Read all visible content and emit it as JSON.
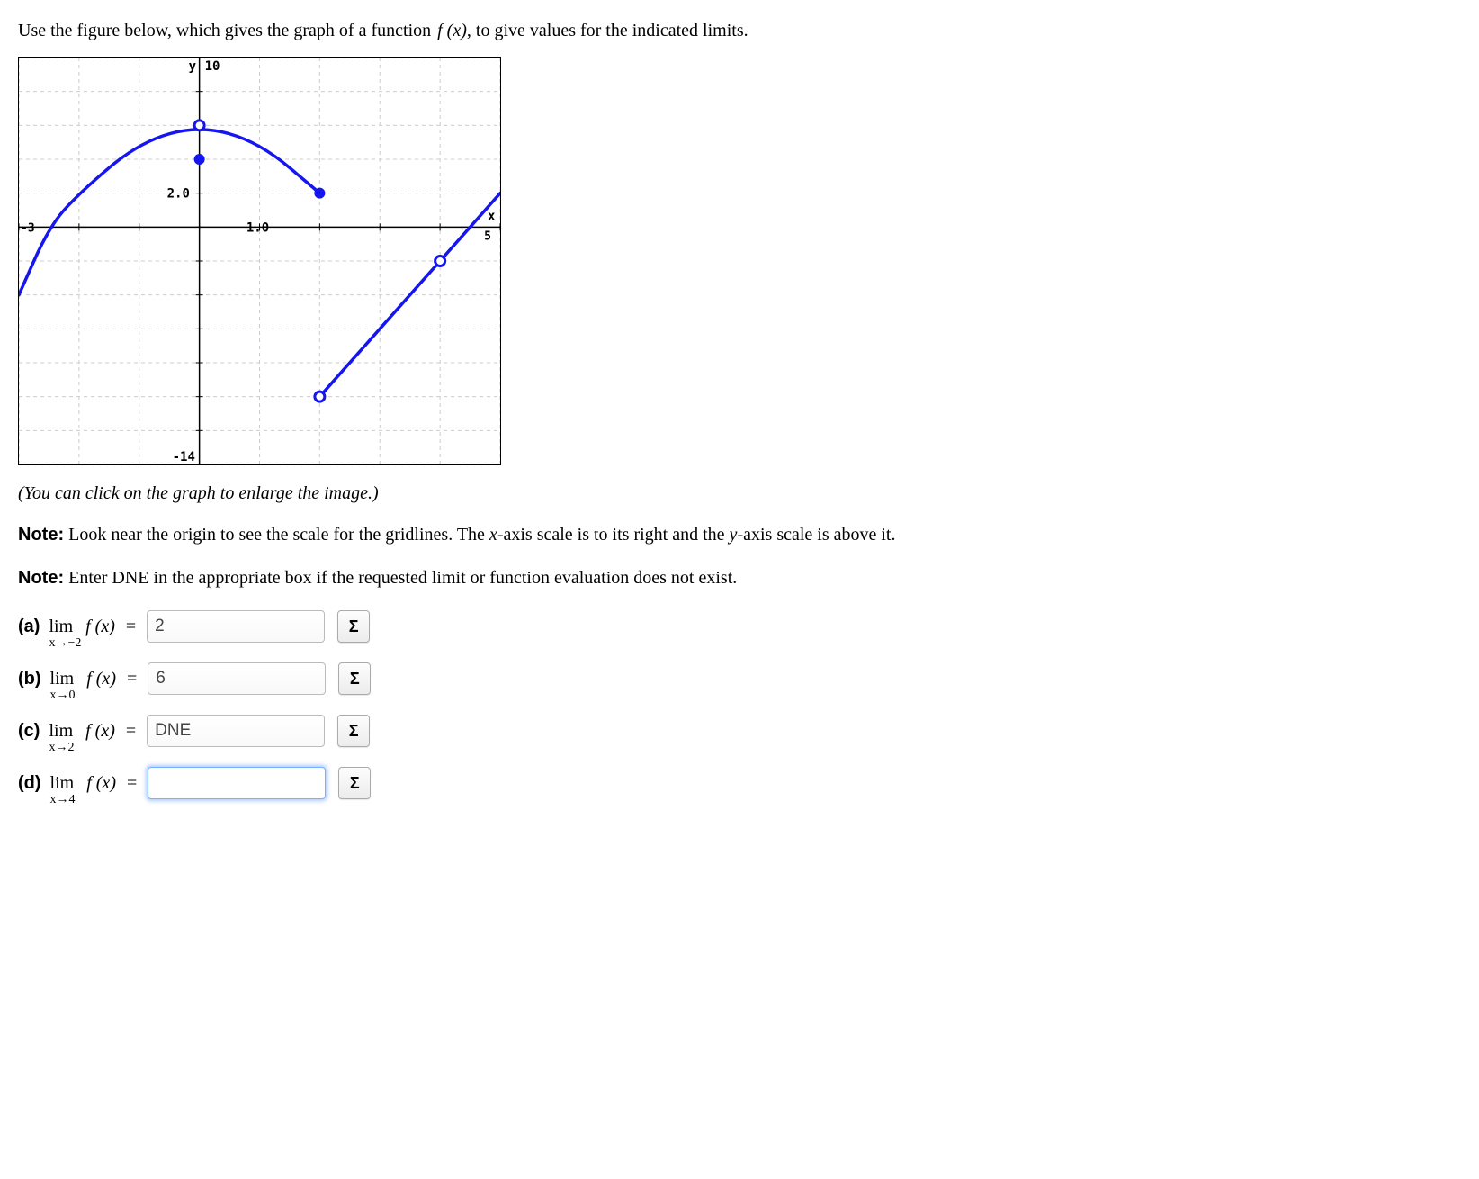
{
  "instruction_prefix": "Use the figure below, which gives the graph of a function ",
  "instruction_fx": "f (x)",
  "instruction_suffix": ", to give values for the indicated limits.",
  "hint": "(You can click on the graph to enlarge the image.)",
  "note1_label": "Note:",
  "note1_text_a": " Look near the origin to see the scale for the gridlines. The ",
  "note1_var1": "x",
  "note1_text_b": "-axis scale is to its right and the ",
  "note1_var2": "y",
  "note1_text_c": "-axis scale is above it.",
  "note2_label": "Note:",
  "note2_text": " Enter DNE in the appropriate box if the requested limit or function evaluation does not exist.",
  "sigma": "Σ",
  "lim_text": "lim",
  "fx_text": "f (x)",
  "eq_text": "=",
  "questions": [
    {
      "label": "(a)",
      "approach": "x→−2",
      "value": "2"
    },
    {
      "label": "(b)",
      "approach": "x→0",
      "value": "6"
    },
    {
      "label": "(c)",
      "approach": "x→2",
      "value": "DNE"
    },
    {
      "label": "(d)",
      "approach": "x→4",
      "value": ""
    }
  ],
  "chart_data": {
    "type": "line",
    "xlabel": "x",
    "ylabel": "y",
    "xlim": [
      -3,
      5
    ],
    "ylim": [
      -14,
      10
    ],
    "x_tick": 1.0,
    "y_tick": 2.0,
    "tick_labels": {
      "x": "1.0",
      "y": "2.0",
      "xmin": "-3",
      "xmax": "5",
      "ymin": "-14",
      "ymax": "10"
    },
    "series": [
      {
        "name": "parabola-left",
        "kind": "curve",
        "points": [
          {
            "x": -3,
            "y": -4
          },
          {
            "x": -2.5,
            "y": 0
          },
          {
            "x": -2,
            "y": 2
          },
          {
            "x": -1,
            "y": 5
          },
          {
            "x": 0,
            "y": 6
          },
          {
            "x": 1,
            "y": 5
          },
          {
            "x": 2,
            "y": 2
          }
        ],
        "end_left": "open_boundary",
        "end_right": "closed"
      },
      {
        "name": "line-right",
        "kind": "line",
        "points": [
          {
            "x": 2,
            "y": -10
          },
          {
            "x": 4,
            "y": -2
          },
          {
            "x": 5,
            "y": 2
          }
        ],
        "end_left": "open",
        "end_right": "open_boundary"
      }
    ],
    "points": [
      {
        "x": 0,
        "y": 6,
        "type": "open"
      },
      {
        "x": 0,
        "y": 4,
        "type": "closed"
      },
      {
        "x": 2,
        "y": 2,
        "type": "closed"
      },
      {
        "x": 2,
        "y": -10,
        "type": "open"
      },
      {
        "x": 4,
        "y": -2,
        "type": "open"
      }
    ]
  }
}
